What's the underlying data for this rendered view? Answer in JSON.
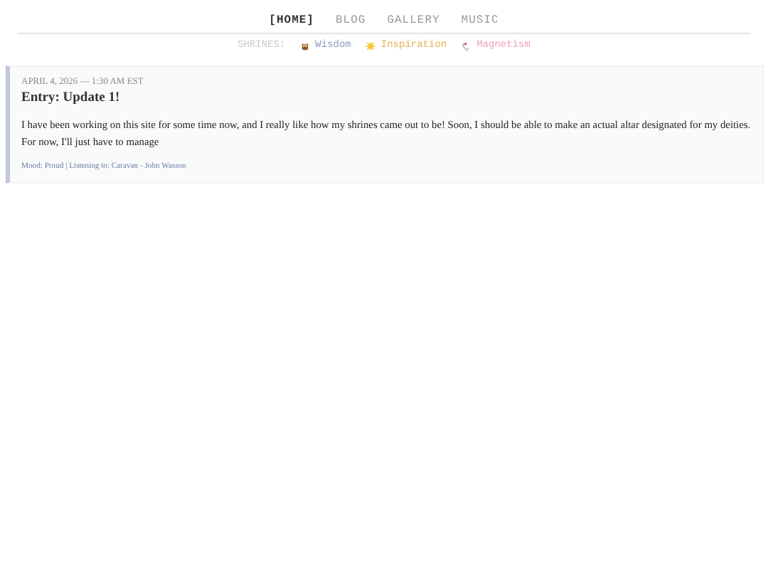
{
  "nav": [
    {
      "label": "[HOME]",
      "selected": true
    },
    {
      "label": "BLOG",
      "selected": false
    },
    {
      "label": "GALLERY",
      "selected": false
    },
    {
      "label": "MUSIC",
      "selected": false
    }
  ],
  "shrines": {
    "label": "SHRINES:",
    "items": [
      {
        "kind": "owl",
        "name": "Wisdom",
        "color": "#8a9cc4"
      },
      {
        "kind": "sun",
        "name": "Inspiration",
        "color": "#e0b050"
      },
      {
        "kind": "magnet",
        "name": "Magnetism",
        "color": "#f0a0c0"
      }
    ]
  },
  "entries": [
    {
      "date": "APRIL 4, 2026 — 1:30 AM EST",
      "title": "Entry: Update 1!",
      "body": "I have been working on this site for some time now, and I really like how my shrines came out to be! Soon, I should be able to make an actual altar designated for my deities. For now, I'll just have to manage",
      "footer": "Mood: Proud | Listening to: Caravan - John Wasson"
    }
  ]
}
